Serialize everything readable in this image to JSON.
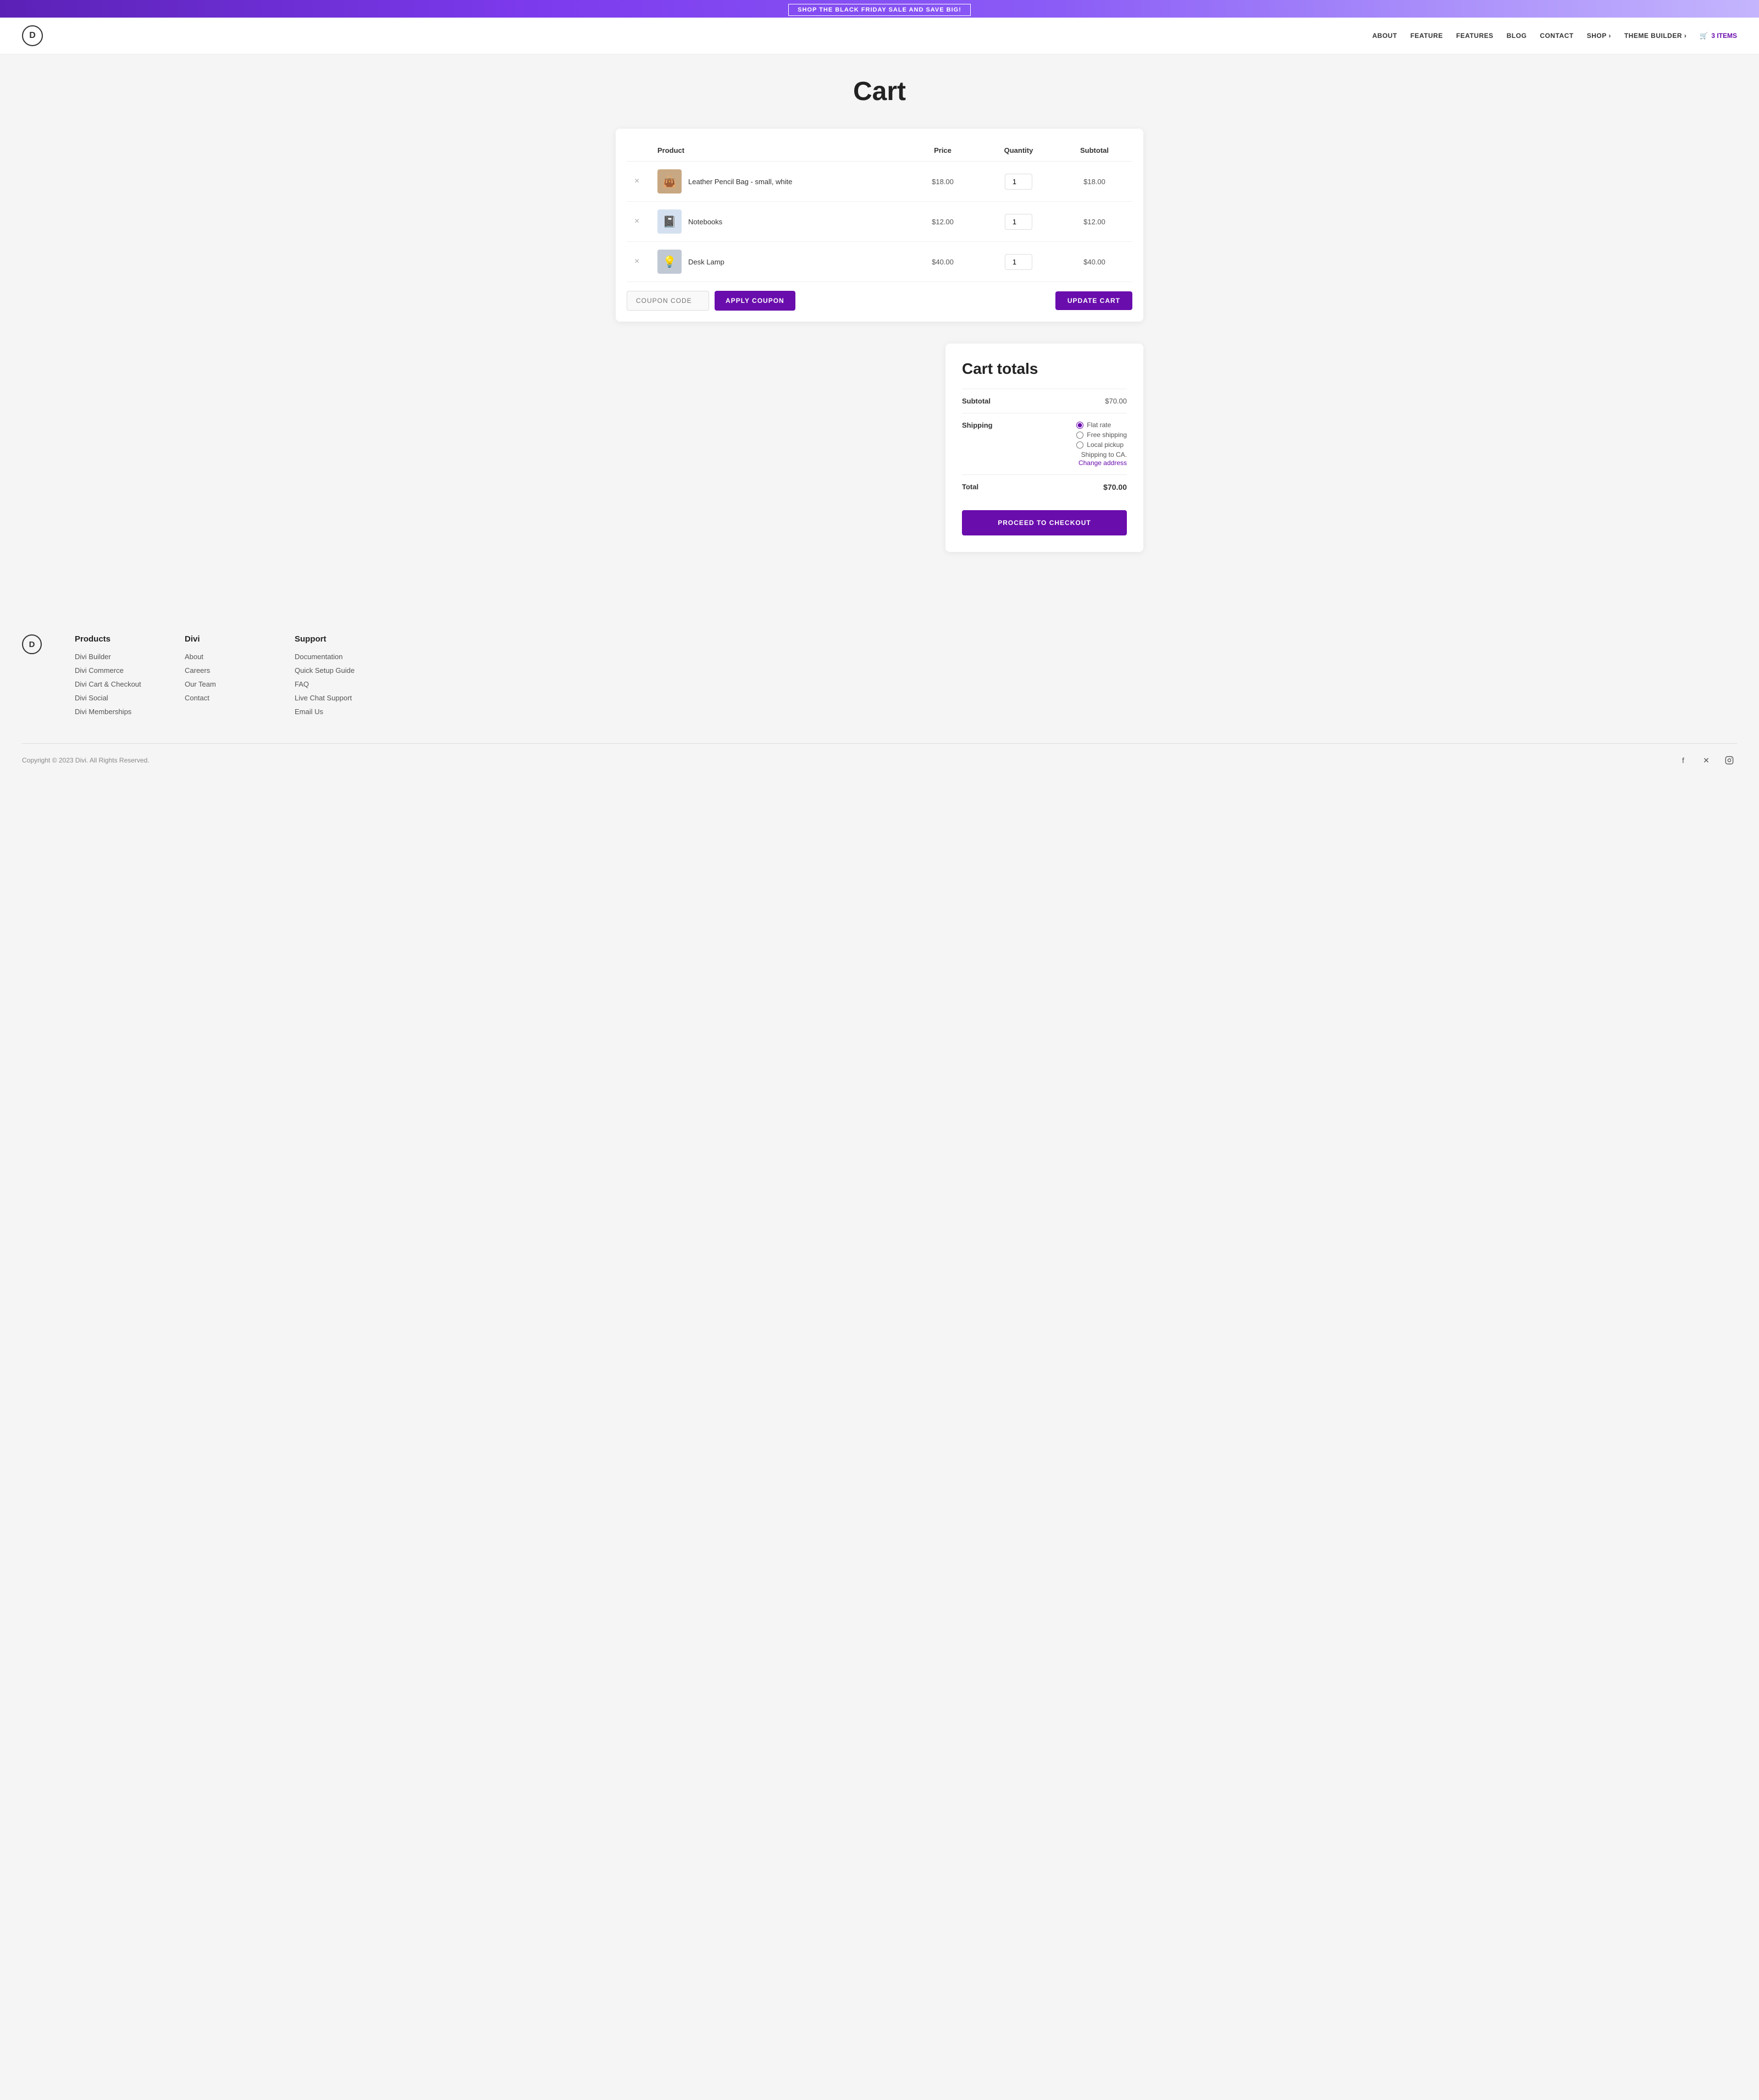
{
  "banner": {
    "text": "SHOP THE BLACK FRIDAY SALE AND SAVE BIG!"
  },
  "header": {
    "logo": "D",
    "nav": {
      "about": "ABOUT",
      "feature": "FEATURE",
      "features": "FEATURES",
      "blog": "BLOG",
      "contact": "CONTACT",
      "shop": "SHOP",
      "theme_builder": "THEME BUILDER",
      "cart_count": "3 ITEMS"
    }
  },
  "page": {
    "title": "Cart"
  },
  "cart": {
    "columns": {
      "product": "Product",
      "price": "Price",
      "quantity": "Quantity",
      "subtotal": "Subtotal"
    },
    "items": [
      {
        "name": "Leather Pencil Bag - small, white",
        "price": "$18.00",
        "qty": "1",
        "subtotal": "$18.00",
        "img_emoji": "👜"
      },
      {
        "name": "Notebooks",
        "price": "$12.00",
        "qty": "1",
        "subtotal": "$12.00",
        "img_emoji": "📓"
      },
      {
        "name": "Desk Lamp",
        "price": "$40.00",
        "qty": "1",
        "subtotal": "$40.00",
        "img_emoji": "💡"
      }
    ],
    "coupon_placeholder": "COUPON CODE",
    "apply_coupon_label": "APPLY COUPON",
    "update_cart_label": "UPDATE CART"
  },
  "cart_totals": {
    "title": "Cart totals",
    "subtotal_label": "Subtotal",
    "subtotal_value": "$70.00",
    "shipping_label": "Shipping",
    "shipping_options": [
      {
        "label": "Flat rate",
        "checked": true
      },
      {
        "label": "Free shipping",
        "checked": false
      },
      {
        "label": "Local pickup",
        "checked": false
      }
    ],
    "shipping_note": "Shipping to CA.",
    "change_address": "Change address",
    "total_label": "Total",
    "total_value": "$70.00",
    "checkout_label": "PROCEED TO CHECKOUT"
  },
  "footer": {
    "logo": "D",
    "products": {
      "heading": "Products",
      "links": [
        "Divi Builder",
        "Divi Commerce",
        "Divi Cart & Checkout",
        "Divi Social",
        "Divi Memberships"
      ]
    },
    "divi": {
      "heading": "Divi",
      "links": [
        "About",
        "Careers",
        "Our Team",
        "Contact"
      ]
    },
    "support": {
      "heading": "Support",
      "links": [
        "Documentation",
        "Quick Setup Guide",
        "FAQ",
        "Live Chat Support",
        "Email Us"
      ]
    },
    "copyright": "Copyright © 2023 Divi. All Rights Reserved.",
    "social": [
      "f",
      "𝕏",
      "◯"
    ]
  }
}
